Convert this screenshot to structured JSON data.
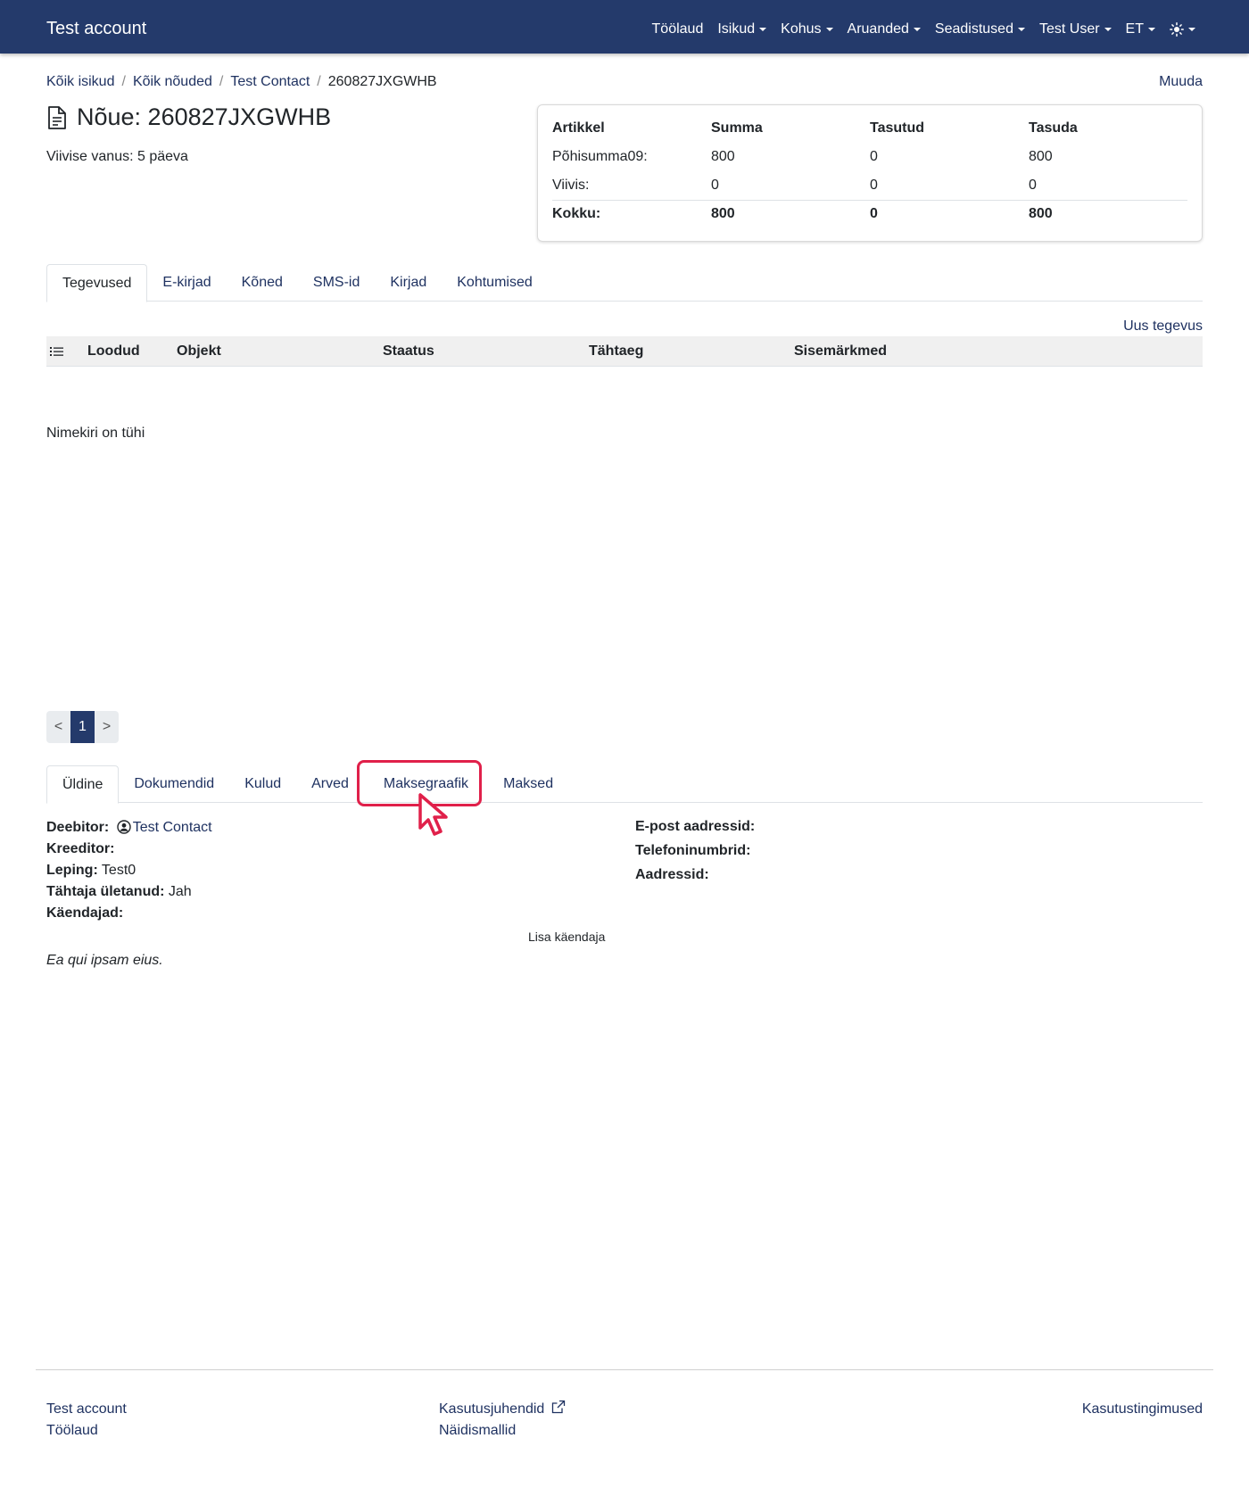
{
  "navbar": {
    "brand": "Test account",
    "items": [
      "Töölaud",
      "Isikud",
      "Kohus",
      "Aruanded",
      "Seadistused",
      "Test User",
      "ET"
    ]
  },
  "breadcrumb": [
    "Kõik isikud",
    "Kõik nõuded",
    "Test Contact",
    "260827JXGWHB"
  ],
  "edit_label": "Muuda",
  "title": "Nõue: 260827JXGWHB",
  "delay_age": "Viivise vanus: 5 päeva",
  "summary": {
    "headers": [
      "Artikkel",
      "Summa",
      "Tasutud",
      "Tasuda"
    ],
    "rows": [
      [
        "Põhisumma09:",
        "800",
        "0",
        "800"
      ],
      [
        "Viivis:",
        "0",
        "0",
        "0"
      ]
    ],
    "total": [
      "Kokku:",
      "800",
      "0",
      "800"
    ]
  },
  "top_tabs": [
    "Tegevused",
    "E-kirjad",
    "Kõned",
    "SMS-id",
    "Kirjad",
    "Kohtumised"
  ],
  "new_activity": "Uus tegevus",
  "activity_columns": [
    "Loodud",
    "Objekt",
    "Staatus",
    "Tähtaeg",
    "Sisemärkmed"
  ],
  "empty_text": "Nimekiri on tühi",
  "pagination": {
    "prev": "<",
    "page": "1",
    "next": ">"
  },
  "bottom_tabs": [
    "Üldine",
    "Dokumendid",
    "Kulud",
    "Arved",
    "Maksegraafik",
    "Maksed"
  ],
  "details": {
    "debtor_label": "Deebitor:",
    "debtor_value": "Test Contact",
    "creditor_label": "Kreeditor:",
    "contract_label": "Leping:",
    "contract_value": "Test0",
    "overdue_label": "Tähtaja ületanud:",
    "overdue_value": "Jah",
    "guarantors_label": "Käendajad:",
    "add_guarantor": "Lisa käendaja",
    "note": "Ea qui ipsam eius.",
    "emails_label": "E-post aadressid:",
    "phones_label": "Telefoninumbrid:",
    "addresses_label": "Aadressid:"
  },
  "footer": {
    "col1": [
      "Test account",
      "Töölaud"
    ],
    "col2": [
      "Kasutusjuhendid",
      "Näidismallid"
    ],
    "col3": [
      "Kasutustingimused"
    ]
  },
  "colors": {
    "navbar": "#243a6b",
    "link": "#1f3261",
    "highlight": "#e0204a"
  }
}
